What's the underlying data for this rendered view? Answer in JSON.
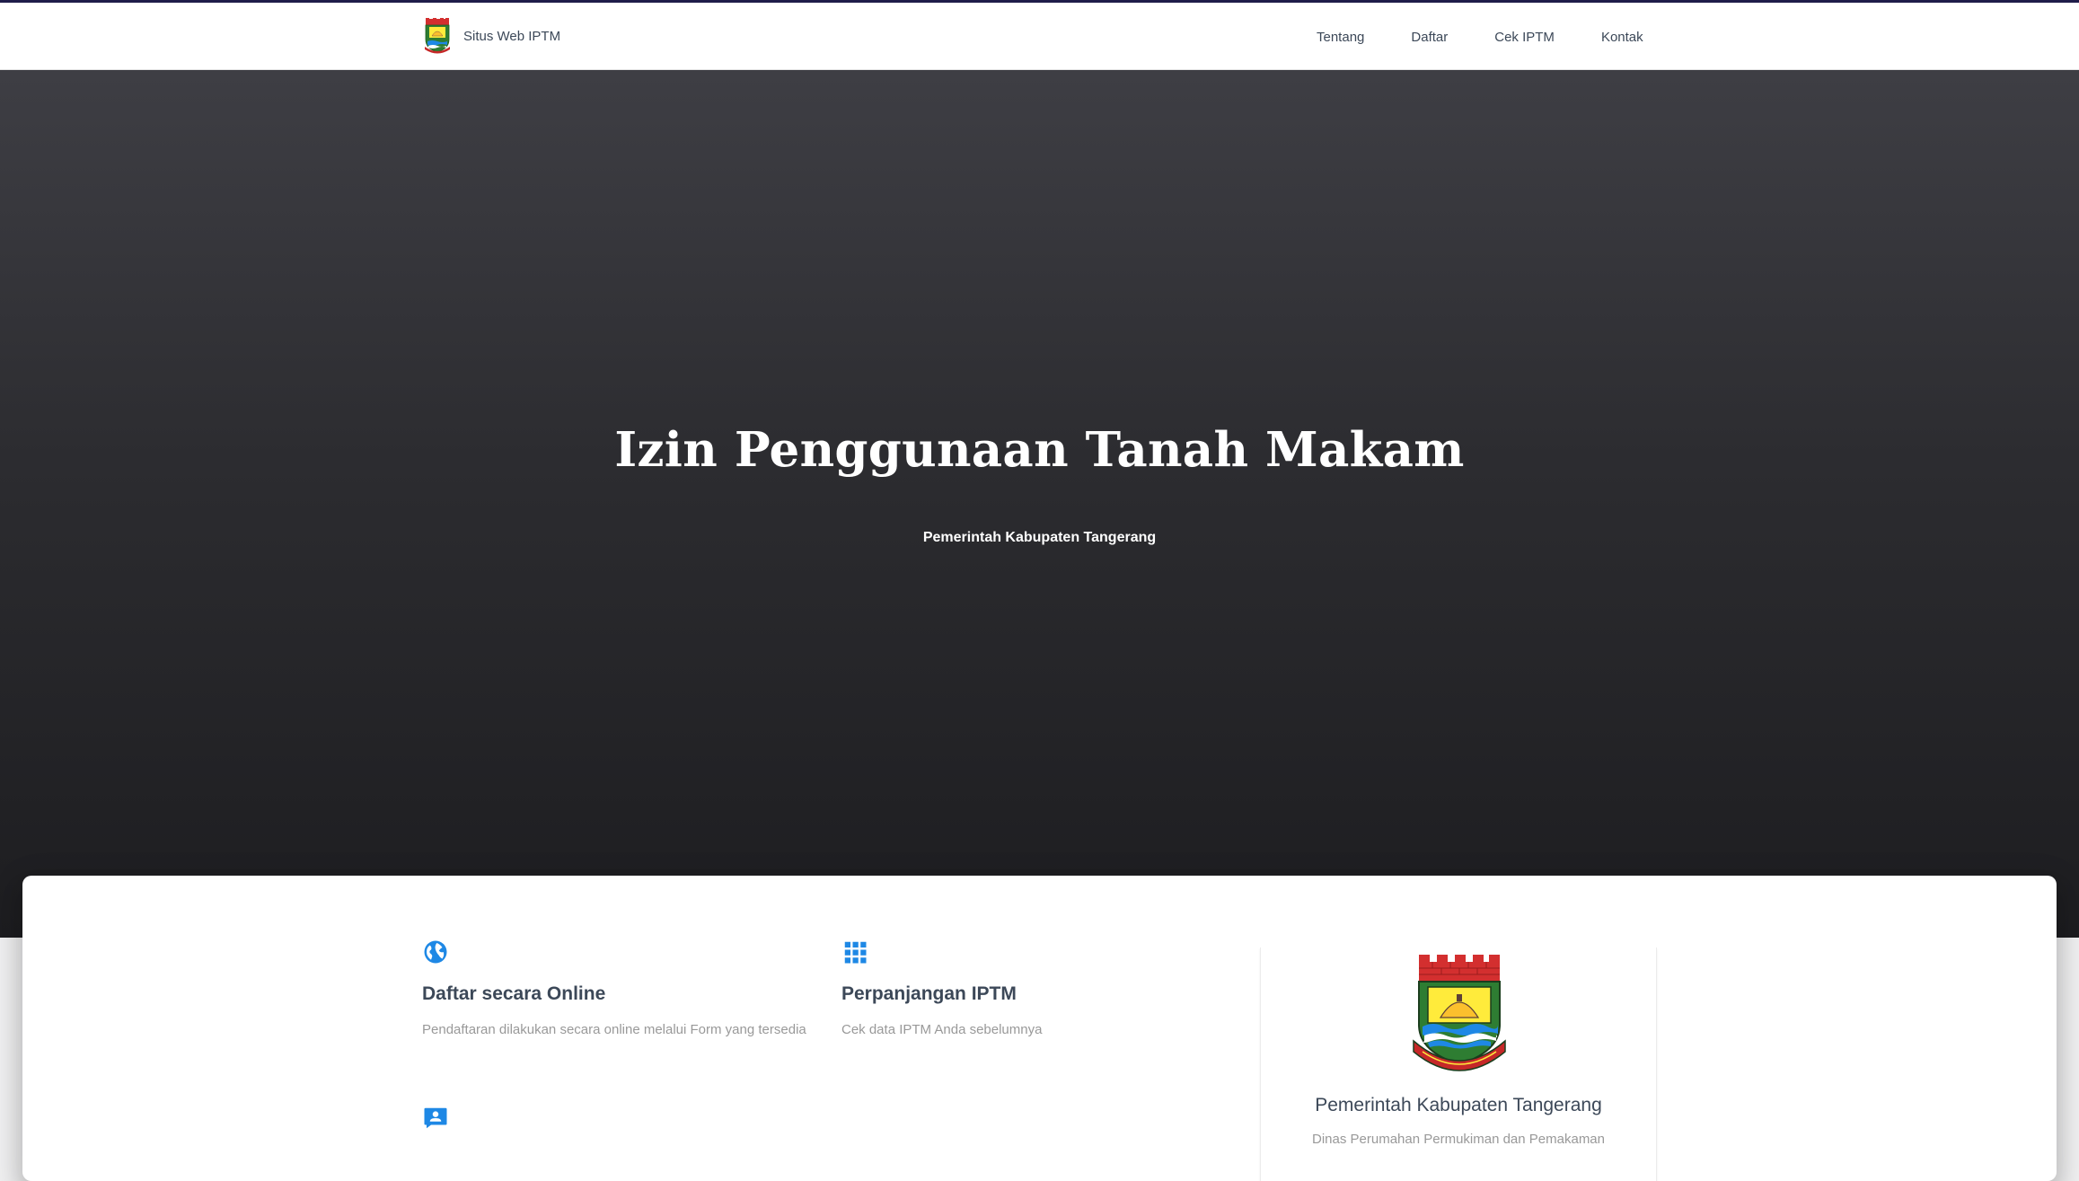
{
  "navbar": {
    "brand": "Situs Web IPTM",
    "links": [
      "Tentang",
      "Daftar",
      "Cek IPTM",
      "Kontak"
    ]
  },
  "hero": {
    "title": "Izin Penggunaan Tanah Makam",
    "subtitle": "Pemerintah Kabupaten Tangerang"
  },
  "features": [
    {
      "icon": "globe-icon",
      "title": "Daftar secara Online",
      "description": "Pendaftaran dilakukan secara online melalui Form yang tersedia"
    },
    {
      "icon": "grid-apps-icon",
      "title": "Perpanjangan IPTM",
      "description": "Cek data IPTM Anda sebelumnya"
    },
    {
      "icon": "contact-card-icon",
      "title": "",
      "description": ""
    }
  ],
  "profile": {
    "name": "Pemerintah Kabupaten Tangerang",
    "department": "Dinas Perumahan Permukiman dan Pemakaman"
  },
  "colors": {
    "accent": "#1e88e5",
    "text_dark": "#3c4858",
    "text_muted": "#999999",
    "hero_top": "#3e3e44",
    "hero_bottom": "#1d1d20",
    "top_line": "#1f1d4a"
  }
}
